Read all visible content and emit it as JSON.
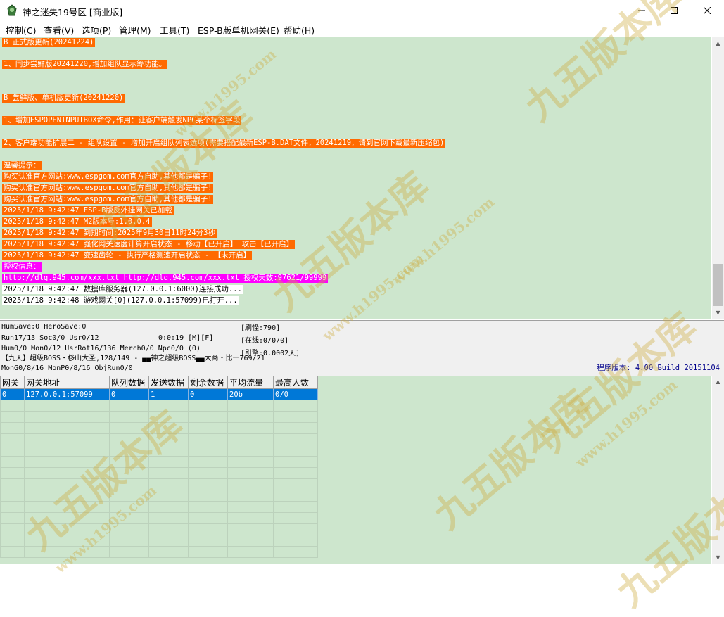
{
  "window": {
    "title": "神之迷失19号区 [商业版]"
  },
  "menu": [
    "控制(C)",
    "查看(V)",
    "选项(P)",
    "管理(M)",
    "工具(T)",
    "ESP-B版单机网关(E)",
    "帮助(H)"
  ],
  "log": [
    {
      "text": "B 正式版更新(20241224)",
      "style": "orange"
    },
    {
      "text": "1、同步尝鲜版20241220,增加组队显示筹功能。",
      "style": "orange"
    },
    {
      "text": "B 尝鲜版、单机版更新(20241220)",
      "style": "orange"
    },
    {
      "text": "1、增加ESPOPENINPUTBOX命令,作用：让客户端触发NPC某个标签字段",
      "style": "orange"
    },
    {
      "text": "2、客户端功能扩展二 - 组队设置 - 增加开启组队列表选项(需要搭配最新ESP-B.DAT文件，20241219，请到官网下载最新压缩包)",
      "style": "orange"
    },
    {
      "text": "温馨提示：",
      "style": "orange"
    },
    {
      "text": "购买认准官方网站:www.espgom.com官方自助,其他都是骗子!",
      "style": "orange"
    },
    {
      "text": "购买认准官方网站:www.espgom.com官方自助,其他都是骗子!",
      "style": "orange"
    },
    {
      "text": "购买认准官方网站:www.espgom.com官方自助,其他都是骗子!",
      "style": "orange"
    },
    {
      "text": "2025/1/18 9:42:47 ESP-B版反外挂网关已加载",
      "style": "orange"
    },
    {
      "text": "2025/1/18 9:42:47 M2版本号:1.0.0.4",
      "style": "orange"
    },
    {
      "text": "2025/1/18 9:42:47 到期时间:2025年9月30日11时24分3秒",
      "style": "orange"
    },
    {
      "text": "2025/1/18 9:42:47 强化网关速度计算开启状态 - 移动【已开启】 攻击【已开启】",
      "style": "orange"
    },
    {
      "text": "2025/1/18 9:42:47 变速齿轮 - 执行严格测速开启状态 - 【未开启】",
      "style": "orange"
    },
    {
      "text": "授权信息：",
      "style": "magenta"
    },
    {
      "text": "http://dlq.945.com/xxx.txt http://dlq.945.com/xxx.txt 授权天数:97621/99999",
      "style": "magenta"
    },
    {
      "text": "2025/1/18 9:42:47 数据库服务器(127.0.0.1:6000)连接成功...",
      "style": "white"
    },
    {
      "text": "2025/1/18 9:42:48 游戏网关[0](127.0.0.1:57099)已打开...",
      "style": "white"
    }
  ],
  "status": {
    "line1": "HumSave:0 HeroSave:0",
    "line2": "Run17/13 Soc0/0 Usr0/12",
    "timer": "0:0:19 [M][F]",
    "line3": "Hum0/0 Mon0/12 UsrRot16/136 Merch0/0 Npc0/0 (0)",
    "line4": "【九天】超级BOSS・移山大圣,128/149 - ▄▄神之超级BOSS▄▄大商・比干769/21",
    "line5": "MonG0/8/16 MonP0/8/16 ObjRun0/0",
    "refresh": "[刷怪:790]",
    "online": "[在线:0/0/0]",
    "engine": "[引擎:0.0002天]",
    "version": "程序版本: 4.00 Build 20151104"
  },
  "grid": {
    "headers": [
      "网关",
      "网关地址",
      "队列数据",
      "发送数据",
      "剩余数据",
      "平均流量",
      "最高人数"
    ],
    "rows": [
      [
        "0",
        "127.0.0.1:57099",
        "0",
        "1",
        "0",
        "20b",
        "0/0"
      ]
    ]
  },
  "watermark": "九五版本库",
  "watermark_url": "www.h1995.com",
  "colors": {
    "log_bg": "#cde6cd",
    "orange": "#ff6a00",
    "magenta": "#ff00ff",
    "selection": "#0078d7"
  }
}
